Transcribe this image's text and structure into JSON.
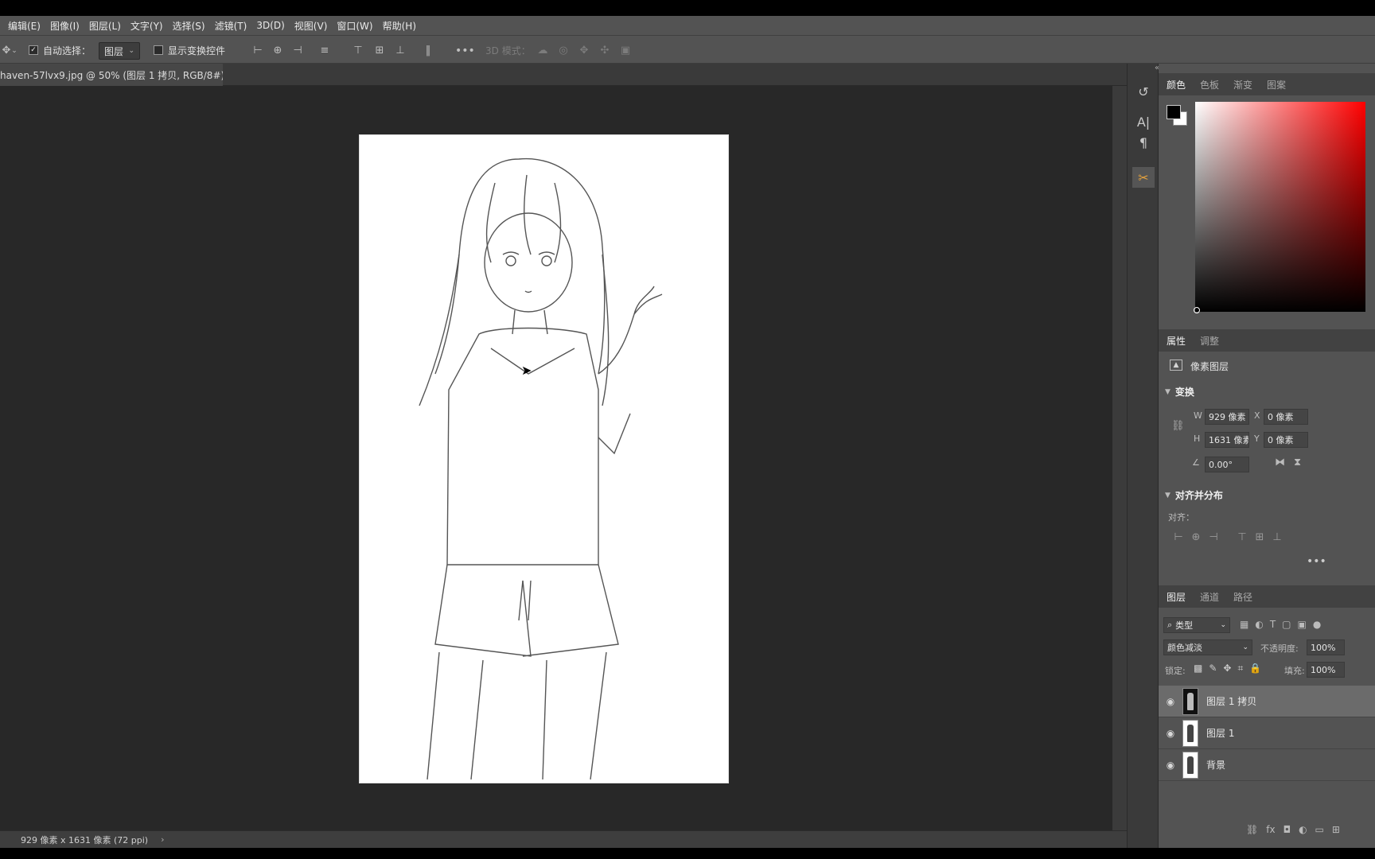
{
  "menubar": {
    "items": [
      "编辑(E)",
      "图像(I)",
      "图层(L)",
      "文字(Y)",
      "选择(S)",
      "滤镜(T)",
      "3D(D)",
      "视图(V)",
      "窗口(W)",
      "帮助(H)"
    ]
  },
  "options": {
    "auto_select_label": "自动选择：",
    "auto_select_value": "图层",
    "show_transform_label": "显示变换控件",
    "mode_3d_label": "3D 模式："
  },
  "document": {
    "tab_title": "haven-57lvx9.jpg @ 50% (图层 1 拷贝, RGB/8#) *",
    "close_glyph": "×",
    "status": "929 像素 x 1631 像素 (72 ppi)",
    "status_arrow": "›"
  },
  "color_panel": {
    "tabs": [
      "颜色",
      "色板",
      "渐变",
      "图案"
    ],
    "foreground": "#000000",
    "background": "#ffffff",
    "hue": "#ff0000"
  },
  "properties": {
    "tabs": [
      "属性",
      "调整"
    ],
    "layer_type": "像素图层",
    "transform_title": "变换",
    "w_label": "W",
    "w_value": "929 像素",
    "h_label": "H",
    "h_value": "1631 像素",
    "x_label": "X",
    "x_value": "0 像素",
    "y_label": "Y",
    "y_value": "0 像素",
    "angle_value": "0.00°",
    "align_title": "对齐并分布",
    "align_label": "对齐："
  },
  "layers": {
    "tabs": [
      "图层",
      "通道",
      "路径"
    ],
    "filter_kind": "类型",
    "blend_mode": "颜色减淡",
    "opacity_label": "不透明度:",
    "opacity_value": "100%",
    "lock_label": "锁定:",
    "fill_label": "填充:",
    "fill_value": "100%",
    "items": [
      {
        "name": "图层 1 拷贝",
        "selected": true,
        "visible": true
      },
      {
        "name": "图层 1",
        "selected": false,
        "visible": true
      },
      {
        "name": "背景",
        "selected": false,
        "visible": true
      }
    ]
  }
}
